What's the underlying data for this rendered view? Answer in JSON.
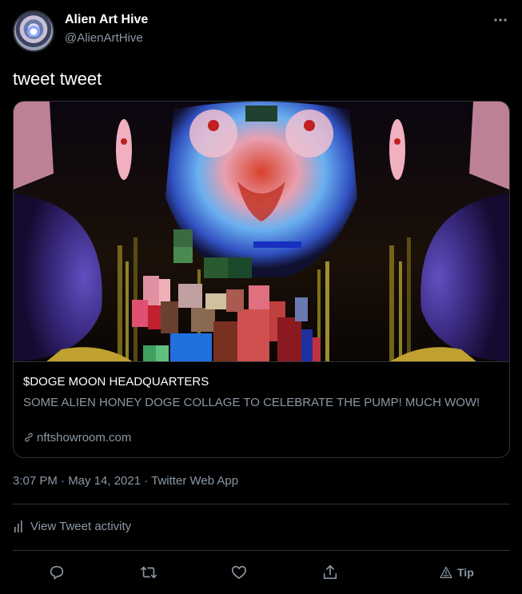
{
  "author": {
    "name": "Alien Art Hive",
    "handle": "@AlienArtHive"
  },
  "tweet": {
    "text": "tweet tweet",
    "timestamp": "3:07 PM · May 14, 2021 · Twitter Web App"
  },
  "card": {
    "title": "$DOGE MOON HEADQUARTERS",
    "description": "SOME ALIEN HONEY DOGE COLLAGE TO CELEBRATE THE PUMP! MUCH WOW!",
    "domain": "nftshowroom.com"
  },
  "activity": {
    "label": "View Tweet activity"
  },
  "actions": {
    "tip_label": "Tip"
  },
  "icons": {
    "more": "more-icon",
    "link": "link-icon",
    "activity": "bar-chart-icon",
    "reply": "reply-icon",
    "retweet": "retweet-icon",
    "like": "heart-icon",
    "share": "share-icon",
    "tip": "tip-icon"
  },
  "colors": {
    "background": "#000000",
    "text_primary": "#ffffff",
    "text_secondary": "#8b98a5",
    "border": "#2f3336"
  }
}
